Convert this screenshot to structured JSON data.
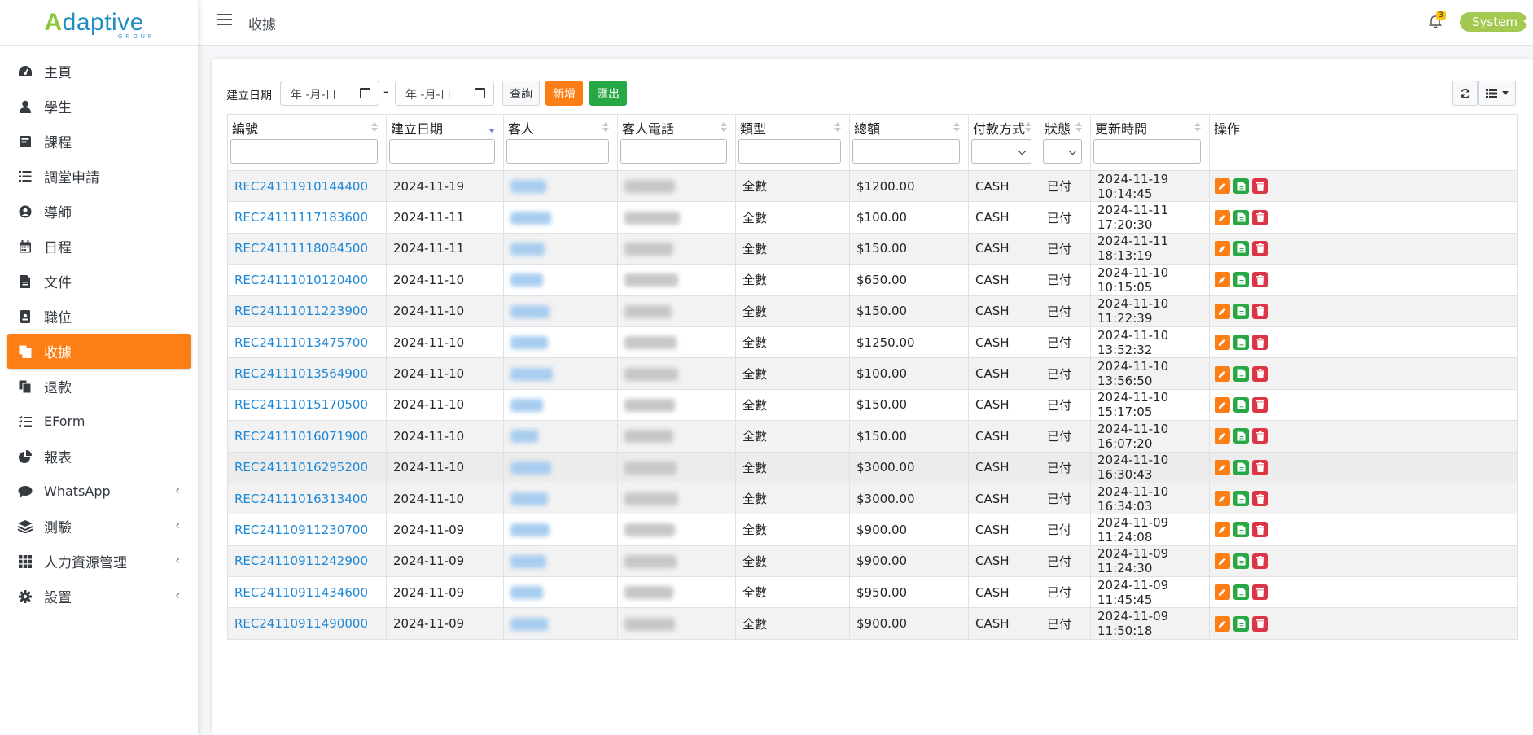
{
  "brand": {
    "logo_main_a": "A",
    "logo_main_rest": "daptive",
    "logo_sub": "GROUP"
  },
  "sidebar": {
    "items": [
      {
        "label": "主頁",
        "icon": "dashboard-icon",
        "active": false,
        "chevron": false
      },
      {
        "label": "學生",
        "icon": "user-icon",
        "active": false,
        "chevron": false
      },
      {
        "label": "課程",
        "icon": "course-icon",
        "active": false,
        "chevron": false
      },
      {
        "label": "調堂申請",
        "icon": "list-icon",
        "active": false,
        "chevron": false
      },
      {
        "label": "導師",
        "icon": "user-circle-icon",
        "active": false,
        "chevron": false
      },
      {
        "label": "日程",
        "icon": "calendar-icon",
        "active": false,
        "chevron": false
      },
      {
        "label": "文件",
        "icon": "file-icon",
        "active": false,
        "chevron": false
      },
      {
        "label": "職位",
        "icon": "id-badge-icon",
        "active": false,
        "chevron": false
      },
      {
        "label": "收據",
        "icon": "copy-icon",
        "active": true,
        "chevron": false
      },
      {
        "label": "退款",
        "icon": "copy-icon",
        "active": false,
        "chevron": false
      },
      {
        "label": "EForm",
        "icon": "tasks-icon",
        "active": false,
        "chevron": false
      },
      {
        "label": "報表",
        "icon": "pie-chart-icon",
        "active": false,
        "chevron": false
      },
      {
        "label": "WhatsApp",
        "icon": "chat-icon",
        "active": false,
        "chevron": true
      },
      {
        "label": "測驗",
        "icon": "layers-icon",
        "active": false,
        "chevron": true
      },
      {
        "label": "人力資源管理",
        "icon": "grid-icon",
        "active": false,
        "chevron": true
      },
      {
        "label": "設置",
        "icon": "gear-icon",
        "active": false,
        "chevron": true
      }
    ]
  },
  "topbar": {
    "title": "收據",
    "notification_count": "3",
    "user": "System"
  },
  "toolbar": {
    "date_label": "建立日期",
    "date_from_placeholder": "年 -月-日",
    "date_to_placeholder": "年 -月-日",
    "dash": "-",
    "query_label": "查詢",
    "add_label": "新增",
    "export_label": "匯出"
  },
  "table": {
    "columns": [
      "編號",
      "建立日期",
      "客人",
      "客人電話",
      "類型",
      "總額",
      "付款方式",
      "狀態",
      "更新時間",
      "操作"
    ],
    "rows": [
      {
        "id": "REC24111910144400",
        "date": "2024-11-19",
        "type": "全數",
        "total": "$1200.00",
        "pay": "CASH",
        "status": "已付",
        "updated": "2024-11-19 10:14:45"
      },
      {
        "id": "REC24111117183600",
        "date": "2024-11-11",
        "type": "全數",
        "total": "$100.00",
        "pay": "CASH",
        "status": "已付",
        "updated": "2024-11-11 17:20:30"
      },
      {
        "id": "REC24111118084500",
        "date": "2024-11-11",
        "type": "全數",
        "total": "$150.00",
        "pay": "CASH",
        "status": "已付",
        "updated": "2024-11-11 18:13:19"
      },
      {
        "id": "REC24111010120400",
        "date": "2024-11-10",
        "type": "全數",
        "total": "$650.00",
        "pay": "CASH",
        "status": "已付",
        "updated": "2024-11-10 10:15:05"
      },
      {
        "id": "REC24111011223900",
        "date": "2024-11-10",
        "type": "全數",
        "total": "$150.00",
        "pay": "CASH",
        "status": "已付",
        "updated": "2024-11-10 11:22:39"
      },
      {
        "id": "REC24111013475700",
        "date": "2024-11-10",
        "type": "全數",
        "total": "$1250.00",
        "pay": "CASH",
        "status": "已付",
        "updated": "2024-11-10 13:52:32"
      },
      {
        "id": "REC24111013564900",
        "date": "2024-11-10",
        "type": "全數",
        "total": "$100.00",
        "pay": "CASH",
        "status": "已付",
        "updated": "2024-11-10 13:56:50"
      },
      {
        "id": "REC24111015170500",
        "date": "2024-11-10",
        "type": "全數",
        "total": "$150.00",
        "pay": "CASH",
        "status": "已付",
        "updated": "2024-11-10 15:17:05"
      },
      {
        "id": "REC24111016071900",
        "date": "2024-11-10",
        "type": "全數",
        "total": "$150.00",
        "pay": "CASH",
        "status": "已付",
        "updated": "2024-11-10 16:07:20"
      },
      {
        "id": "REC24111016295200",
        "date": "2024-11-10",
        "type": "全數",
        "total": "$3000.00",
        "pay": "CASH",
        "status": "已付",
        "updated": "2024-11-10 16:30:43"
      },
      {
        "id": "REC24111016313400",
        "date": "2024-11-10",
        "type": "全數",
        "total": "$3000.00",
        "pay": "CASH",
        "status": "已付",
        "updated": "2024-11-10 16:34:03"
      },
      {
        "id": "REC24110911230700",
        "date": "2024-11-09",
        "type": "全數",
        "total": "$900.00",
        "pay": "CASH",
        "status": "已付",
        "updated": "2024-11-09 11:24:08"
      },
      {
        "id": "REC24110911242900",
        "date": "2024-11-09",
        "type": "全數",
        "total": "$900.00",
        "pay": "CASH",
        "status": "已付",
        "updated": "2024-11-09 11:24:30"
      },
      {
        "id": "REC24110911434600",
        "date": "2024-11-09",
        "type": "全數",
        "total": "$950.00",
        "pay": "CASH",
        "status": "已付",
        "updated": "2024-11-09 11:45:45"
      },
      {
        "id": "REC24110911490000",
        "date": "2024-11-09",
        "type": "全數",
        "total": "$900.00",
        "pay": "CASH",
        "status": "已付",
        "updated": "2024-11-09 11:50:18"
      }
    ]
  },
  "colors": {
    "accent": "#fd7e14",
    "success": "#28a745",
    "danger": "#dc3545",
    "link": "#1e88d6",
    "user_pill": "#a3c950"
  }
}
